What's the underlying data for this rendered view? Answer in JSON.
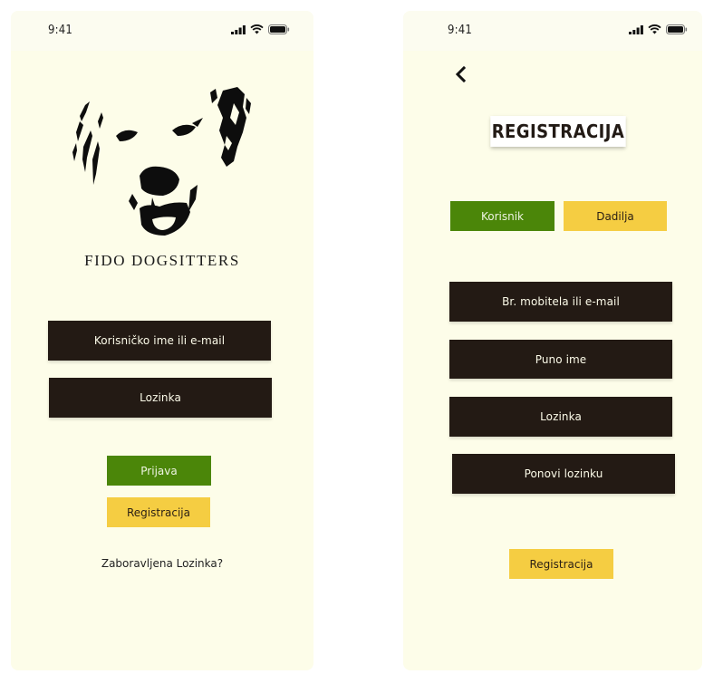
{
  "status_bar": {
    "time": "9:41",
    "icons": [
      "signal-icon",
      "wifi-icon",
      "battery-icon"
    ]
  },
  "login": {
    "brand": "FIDO DOGSITTERS",
    "username_placeholder": "Korisničko ime ili e-mail",
    "password_placeholder": "Lozinka",
    "login_button": "Prijava",
    "register_button": "Registracija",
    "forgot_link": "Zaboravljena Lozinka?"
  },
  "register": {
    "title": "REGISTRACIJA",
    "tabs": [
      {
        "label": "Korisnik",
        "active": true
      },
      {
        "label": "Dadilja",
        "active": false
      }
    ],
    "fields": [
      "Br. mobitela ili e-mail",
      "Puno ime",
      "Lozinka",
      "Ponovi lozinku"
    ],
    "submit_button": "Registracija"
  },
  "colors": {
    "background": "#fdfde9",
    "dark": "#231a14",
    "green": "#4b8609",
    "yellow": "#f5cd42"
  }
}
